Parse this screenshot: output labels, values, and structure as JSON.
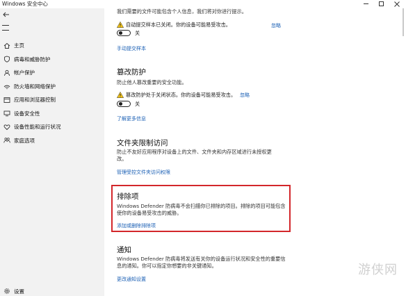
{
  "window": {
    "title": "Windows 安全中心"
  },
  "sidebar": {
    "items": [
      {
        "label": "主页",
        "icon": "home-icon"
      },
      {
        "label": "病毒和威胁防护",
        "icon": "shield-icon"
      },
      {
        "label": "帐户保护",
        "icon": "person-icon"
      },
      {
        "label": "防火墙和网络保护",
        "icon": "network-icon"
      },
      {
        "label": "应用和浏览器控制",
        "icon": "app-browser-icon"
      },
      {
        "label": "设备安全性",
        "icon": "device-security-icon"
      },
      {
        "label": "设备性能和运行状况",
        "icon": "heart-icon"
      },
      {
        "label": "家庭选项",
        "icon": "family-icon"
      }
    ],
    "settings_label": "设置"
  },
  "auto_sample": {
    "intro": "我们需要的文件可能包含个人信息，我们将对你进行提示。",
    "warning": "自动提交样本已关闭。你的设备可能易受攻击。",
    "dismiss": "忽略",
    "toggle_label": "关",
    "manual_link": "手动提交样本"
  },
  "tamper": {
    "heading": "篡改防护",
    "description": "防止他人篡改重要的安全功能。",
    "warning": "篡改防护处于关闭状态。你的设备可能易受攻击。",
    "dismiss": "忽略",
    "toggle_label": "关",
    "learn_more": "了解更多信息"
  },
  "folder_access": {
    "heading": "文件夹限制访问",
    "description_line1": "防止不友好应用程序对设备上的文件、文件夹和内存区域进行未授权更",
    "description_line2": "改。",
    "link": "管理受控文件夹访问权限"
  },
  "exclusions": {
    "heading": "排除项",
    "description_line1": "Windows Defender 防病毒不会扫描你已排除的项目。排除的项目可能包含",
    "description_line2": "使你的设备易受攻击的威胁。",
    "link": "添加或删除排除项"
  },
  "notifications": {
    "heading": "通知",
    "description_line1": "Windows Defender 防病毒将发送有关你的设备运行状况和安全性的重要信",
    "description_line2": "息的通知。你可以指定你想要的非关键通知。",
    "link": "更改通知设置"
  },
  "watermark": {
    "text": "游侠网"
  },
  "colors": {
    "accent_link": "#1a5fb4",
    "highlight": "#d3262a",
    "sidebar_bg": "#f2f2f2",
    "warning_yellow": "#f5c518"
  }
}
